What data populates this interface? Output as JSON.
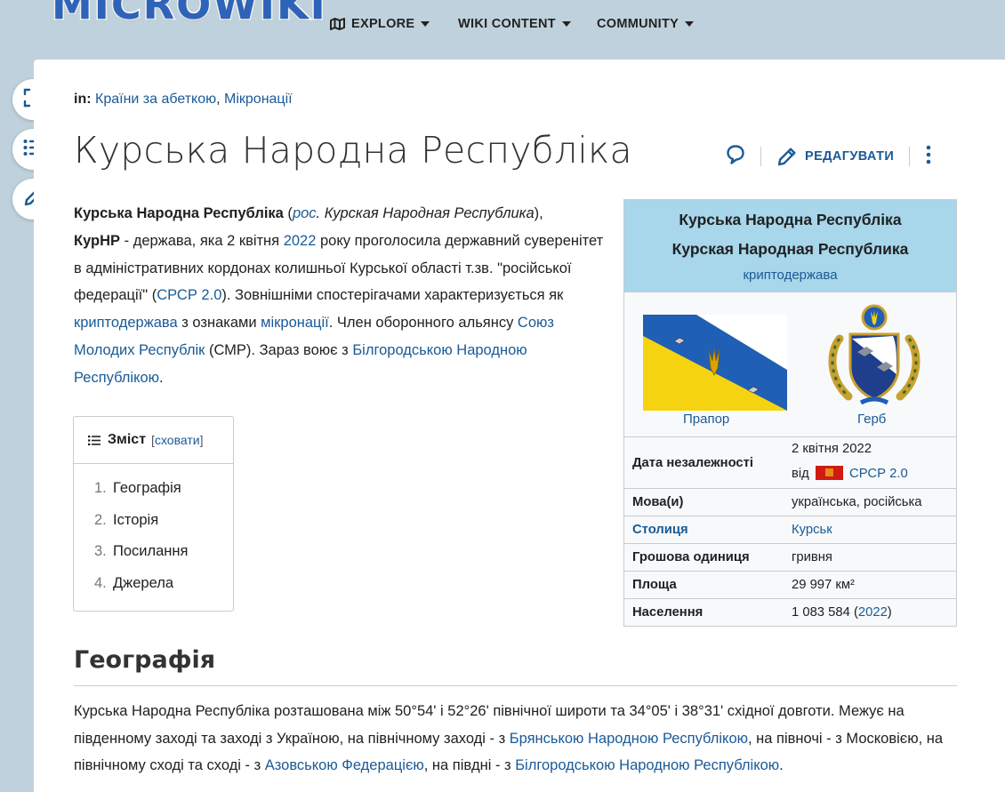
{
  "site": {
    "logo": "MICROWIKI"
  },
  "nav": [
    {
      "label": "EXPLORE"
    },
    {
      "label": "WIKI CONTENT"
    },
    {
      "label": "COMMUNITY"
    }
  ],
  "page": {
    "cats_prefix": "in:",
    "cats": [
      "Країни за абеткою",
      "Мікронації"
    ],
    "cats_sep": ", ",
    "title": "Курська Народна Республіка",
    "edit_label": "РЕДАГУВАТИ"
  },
  "intro": {
    "s1": "Курська Народна Республіка",
    "s2": " (",
    "s3": "рос",
    "s4": ". Курская Народная Республика",
    "s5": "),",
    "s6": "КурНР",
    "s7": " - держава, яка 2 квітня ",
    "s8": "2022",
    "s9": " року проголосила державний суверенітет в адміністративних кордонах колишньої Курської області т.зв. \"російської федерації\" (",
    "s10": "СРСР 2.0",
    "s11": "). Зовнішніми спостерігачами характеризується як ",
    "s12": "криптодержава",
    "s13": " з ознаками ",
    "s14": "мікронації",
    "s15": ". Член оборонного альянсу ",
    "s16": "Союз Молодих Республік",
    "s17": " (СМР). Зараз воює з ",
    "s18": "Білгородською Народною Республікою",
    "s19": "."
  },
  "toc": {
    "title": "Зміст",
    "hide_open": "[",
    "hide": "сховати",
    "hide_close": "]",
    "items": [
      {
        "num": "1.",
        "label": "Географія"
      },
      {
        "num": "2.",
        "label": "Історія"
      },
      {
        "num": "3.",
        "label": "Посилання"
      },
      {
        "num": "4.",
        "label": "Джерела"
      }
    ]
  },
  "infobox": {
    "title_uk": "Курська Народна Республіка",
    "title_ru": "Курская Народная Республика",
    "subtitle": "криптодержава",
    "flag_caption": "Прапор",
    "coat_caption": "Герб",
    "independence_label": "Дата незалежності",
    "independence_date": "2 квітня 2022",
    "independence_from": "від",
    "independence_from_link": "СРСР 2.0",
    "rows": [
      {
        "k": "Мова(и)",
        "v": "українська, російська"
      },
      {
        "k": "Столиця",
        "v": "Курськ"
      },
      {
        "k": "Грошова одиниця",
        "v": "гривня"
      },
      {
        "k": "Площа",
        "v": "29 997 км²"
      }
    ],
    "population_label": "Населення",
    "population_value": "1 083 584 (",
    "population_year": "2022",
    "population_close": ")"
  },
  "geo": {
    "heading": "Географія",
    "p1": "Курська Народна Республіка розташована між 50°54' і 52°26' північної широти та 34°05' і 38°31' східної довготи. Межує на південному заході та заході з Україною, на північному заході - з ",
    "p2": "Брянською Народною Республікою",
    "p3": ", на півночі - з Московією, на північному сході та сході - з ",
    "p4": "Азовською Федерацією",
    "p5": ", на півдні - з ",
    "p6": "Білгородською Народною Республікою",
    "p7": "."
  },
  "colors": {
    "link": "#1a5a96",
    "header_bg": "#bfd1dc",
    "infobox_head": "#a8d6ea",
    "flag_blue": "#1f5fb5",
    "flag_yellow": "#f6d310"
  }
}
